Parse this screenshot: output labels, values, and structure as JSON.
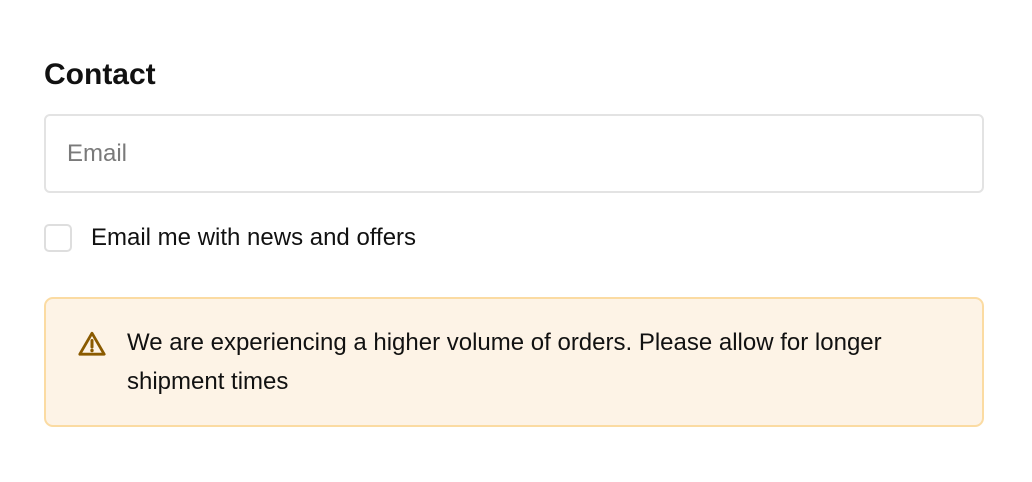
{
  "contact": {
    "title": "Contact",
    "email_placeholder": "Email",
    "email_value": ""
  },
  "newsletter": {
    "label": "Email me with news and offers",
    "checked": false
  },
  "notice": {
    "icon": "warning-triangle-icon",
    "message": "We are experiencing a higher volume of orders. Please allow for longer shipment times"
  },
  "colors": {
    "notice_background": "#fdf3e6",
    "notice_border": "#fbdba2",
    "notice_icon": "#8a5a00",
    "field_border": "#e3e3e3",
    "placeholder": "#7a7a7a"
  }
}
